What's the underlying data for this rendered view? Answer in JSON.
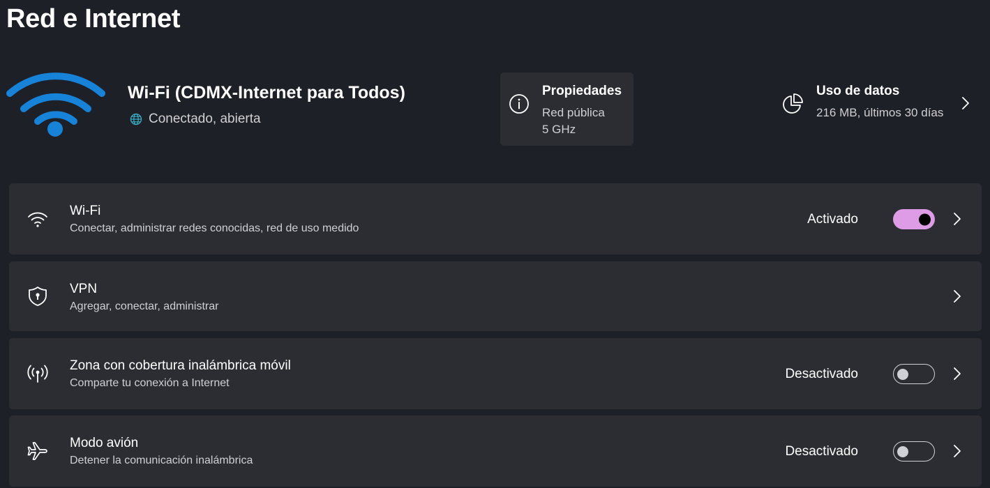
{
  "page": {
    "title": "Red e Internet"
  },
  "network": {
    "name": "Wi-Fi (CDMX-Internet para Todos)",
    "status": "Conectado, abierta",
    "icon": "wifi-signal-icon",
    "accent_color": "#1683d8"
  },
  "properties": {
    "title": "Propiedades",
    "network_type": "Red pública",
    "band": "5 GHz",
    "icon": "info-icon"
  },
  "data_usage": {
    "title": "Uso de datos",
    "summary": "216 MB, últimos 30 días",
    "icon": "pie-chart-icon"
  },
  "settings": [
    {
      "id": "wifi",
      "title": "Wi-Fi",
      "subtitle": "Conectar, administrar redes conocidas, red de uso medido",
      "state_label": "Activado",
      "toggle_on": true,
      "icon": "wifi-icon"
    },
    {
      "id": "vpn",
      "title": "VPN",
      "subtitle": "Agregar, conectar, administrar",
      "icon": "shield-lock-icon"
    },
    {
      "id": "hotspot",
      "title": "Zona con cobertura inalámbrica móvil",
      "subtitle": "Comparte tu conexión a Internet",
      "state_label": "Desactivado",
      "toggle_on": false,
      "icon": "hotspot-icon"
    },
    {
      "id": "airplane",
      "title": "Modo avión",
      "subtitle": "Detener la comunicación inalámbrica",
      "state_label": "Desactivado",
      "toggle_on": false,
      "icon": "airplane-icon"
    }
  ],
  "colors": {
    "background": "#1d2026",
    "card": "#2b2d33",
    "toggle_on": "#de9ce6",
    "text_secondary": "#cfd0d3"
  }
}
